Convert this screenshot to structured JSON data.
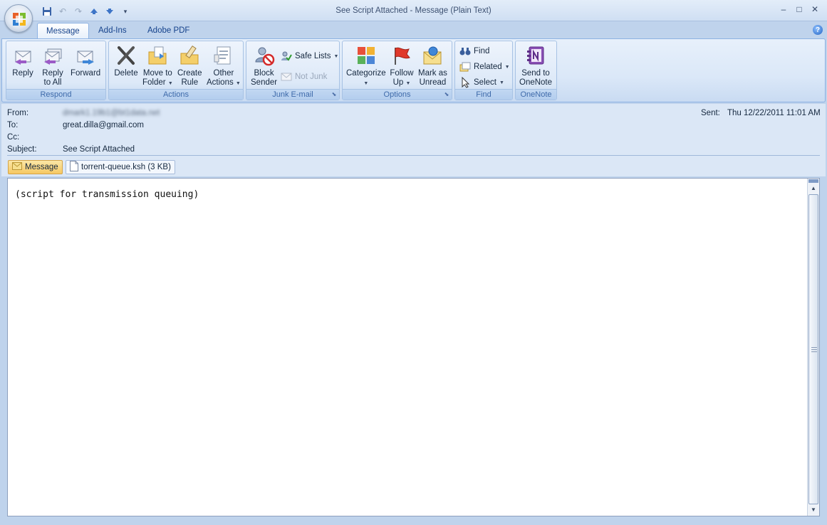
{
  "window": {
    "title": "See Script Attached - Message (Plain Text)",
    "minimize": "–",
    "maximize": "□",
    "close": "✕"
  },
  "quick_access": {
    "customize": "▾"
  },
  "tabs": [
    {
      "label": "Message",
      "active": true
    },
    {
      "label": "Add-Ins",
      "active": false
    },
    {
      "label": "Adobe PDF",
      "active": false
    }
  ],
  "help": "?",
  "ribbon": {
    "respond": {
      "label": "Respond",
      "reply": "Reply",
      "reply_all_1": "Reply",
      "reply_all_2": "to All",
      "forward": "Forward"
    },
    "actions": {
      "label": "Actions",
      "delete": "Delete",
      "move_1": "Move to",
      "move_2": "Folder",
      "create_1": "Create",
      "create_2": "Rule",
      "other_1": "Other",
      "other_2": "Actions"
    },
    "junk": {
      "label": "Junk E-mail",
      "block_1": "Block",
      "block_2": "Sender",
      "safe_lists": "Safe Lists",
      "not_junk": "Not Junk"
    },
    "options": {
      "label": "Options",
      "categorize": "Categorize",
      "follow_1": "Follow",
      "follow_2": "Up",
      "mark_1": "Mark as",
      "mark_2": "Unread"
    },
    "find": {
      "label": "Find",
      "find": "Find",
      "related": "Related",
      "select": "Select"
    },
    "onenote": {
      "label": "OneNote",
      "send_1": "Send to",
      "send_2": "OneNote"
    }
  },
  "header": {
    "from_label": "From:",
    "from_value": "dmark1.19b1@bt1data.net",
    "to_label": "To:",
    "to_value": "great.dilla@gmail.com",
    "cc_label": "Cc:",
    "subject_label": "Subject:",
    "subject_value": "See Script Attached",
    "sent_label": "Sent:",
    "sent_value": "Thu 12/22/2011 11:01 AM"
  },
  "attachments": {
    "message_tab": "Message",
    "file": "torrent-queue.ksh (3 KB)"
  },
  "body": {
    "text": "(script for transmission queuing)"
  }
}
